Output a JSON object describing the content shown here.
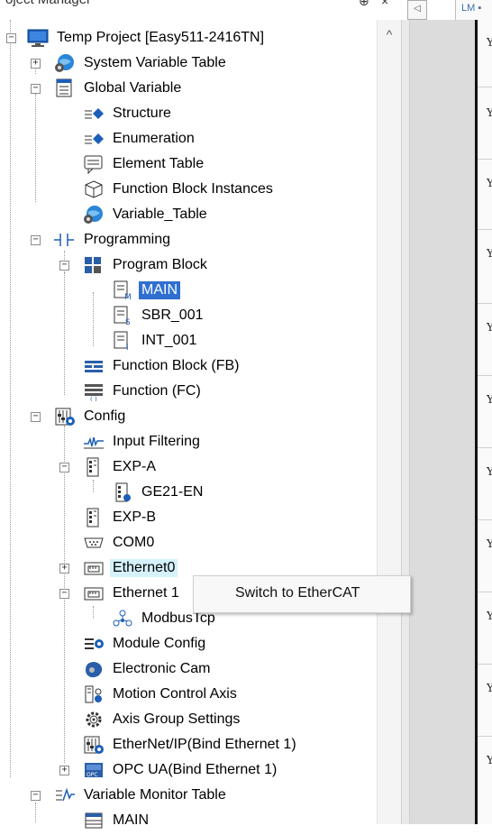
{
  "header": {
    "panel_title": "oject Manager",
    "pin_glyph": "⊕",
    "close_glyph": "×",
    "right_tab_arrow": "◁",
    "right_tab_label": "LM ▪"
  },
  "tree": {
    "root": "Temp Project [Easy511-2416TN]",
    "system_variable_table": "System Variable Table",
    "global_variable": "Global Variable",
    "structure": "Structure",
    "enumeration": "Enumeration",
    "element_table": "Element Table",
    "function_block_instances": "Function Block Instances",
    "variable_table": "Variable_Table",
    "programming": "Programming",
    "program_block": "Program Block",
    "main": "MAIN",
    "sbr_001": "SBR_001",
    "int_001": "INT_001",
    "function_block_fb": "Function Block (FB)",
    "function_fc": "Function (FC)",
    "config": "Config",
    "input_filtering": "Input Filtering",
    "exp_a": "EXP-A",
    "ge21_en": "GE21-EN",
    "exp_b": "EXP-B",
    "com0": "COM0",
    "ethernet0": "Ethernet0",
    "ethernet1": "Ethernet 1",
    "modbustcp": "ModbusTcp",
    "module_config": "Module Config",
    "electronic_cam": "Electronic Cam",
    "motion_control_axis": "Motion Control Axis",
    "axis_group_settings": "Axis Group Settings",
    "ethernet_ip": "EtherNet/IP(Bind Ethernet 1)",
    "opc_ua": "OPC UA(Bind Ethernet 1)",
    "variable_monitor_table": "Variable Monitor Table",
    "monitor_main": "MAIN"
  },
  "expanders": {
    "root": "−",
    "system_variable_table": "+",
    "global_variable": "−",
    "programming": "−",
    "program_block": "−",
    "config": "−",
    "exp_a": "−",
    "ethernet0": "+",
    "ethernet1": "−",
    "opc_ua": "+",
    "variable_monitor_table": "−"
  },
  "scrollbar": {
    "up_glyph": "^"
  },
  "context_menu": {
    "item": "Switch to EtherCAT"
  },
  "editor": {
    "marker": "Y"
  },
  "colors": {
    "selection": "#2f6fd0",
    "hover": "#d5f1fb",
    "icon_blue": "#1d5fb8",
    "icon_globe": "#2a86d6"
  },
  "icons": {
    "root": "monitor-icon",
    "system_variable_table": "globe-gear-icon",
    "global_variable": "table-document-icon",
    "structure": "diamond-list-icon",
    "enumeration": "diamond-list-icon",
    "element_table": "speech-table-icon",
    "function_block_instances": "cube-icon",
    "variable_table": "globe-gear-icon",
    "programming": "ladder-contact-icon",
    "program_block": "blocks-icon",
    "main": "main-program-icon",
    "sbr_001": "subroutine-icon",
    "int_001": "interrupt-icon",
    "function_block_fb": "function-block-icon",
    "function_fc": "function-icon",
    "config": "config-sliders-icon",
    "input_filtering": "waveform-icon",
    "exp_a": "expansion-module-icon",
    "ge21_en": "expansion-module-icon",
    "exp_b": "expansion-module-icon",
    "com0": "serial-port-icon",
    "ethernet0": "ethernet-port-icon",
    "ethernet1": "ethernet-port-icon",
    "modbustcp": "network-nodes-icon",
    "module_config": "module-config-icon",
    "electronic_cam": "cam-icon",
    "motion_control_axis": "axis-icon",
    "axis_group_settings": "gear-icon",
    "ethernet_ip": "config-sliders-icon",
    "opc_ua": "opc-icon",
    "variable_monitor_table": "monitor-chart-icon",
    "monitor_main": "table-icon"
  }
}
